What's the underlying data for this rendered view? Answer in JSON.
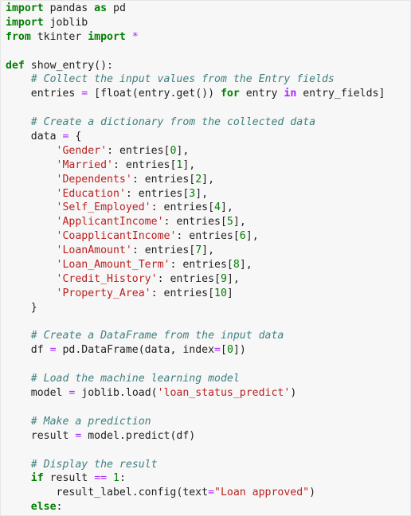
{
  "code_lines": [
    [
      {
        "t": "import",
        "c": "kw"
      },
      {
        "t": " pandas ",
        "c": "pl"
      },
      {
        "t": "as",
        "c": "kw"
      },
      {
        "t": " pd",
        "c": "pl"
      }
    ],
    [
      {
        "t": "import",
        "c": "kw"
      },
      {
        "t": " joblib",
        "c": "pl"
      }
    ],
    [
      {
        "t": "from",
        "c": "kw"
      },
      {
        "t": " tkinter ",
        "c": "pl"
      },
      {
        "t": "import",
        "c": "kw"
      },
      {
        "t": " ",
        "c": "pl"
      },
      {
        "t": "*",
        "c": "op"
      }
    ],
    [],
    [
      {
        "t": "def",
        "c": "kw"
      },
      {
        "t": " show_entry():",
        "c": "pl"
      }
    ],
    [
      {
        "t": "    ",
        "c": "pl"
      },
      {
        "t": "# Collect the input values from the Entry fields",
        "c": "com"
      }
    ],
    [
      {
        "t": "    entries ",
        "c": "pl"
      },
      {
        "t": "=",
        "c": "op"
      },
      {
        "t": " [float(entry.get()) ",
        "c": "pl"
      },
      {
        "t": "for",
        "c": "kw"
      },
      {
        "t": " entry ",
        "c": "pl"
      },
      {
        "t": "in",
        "c": "kw2"
      },
      {
        "t": " entry_fields]",
        "c": "pl"
      }
    ],
    [],
    [
      {
        "t": "    ",
        "c": "pl"
      },
      {
        "t": "# Create a dictionary from the collected data",
        "c": "com"
      }
    ],
    [
      {
        "t": "    data ",
        "c": "pl"
      },
      {
        "t": "=",
        "c": "op"
      },
      {
        "t": " {",
        "c": "pl"
      }
    ],
    [
      {
        "t": "        ",
        "c": "pl"
      },
      {
        "t": "'Gender'",
        "c": "str"
      },
      {
        "t": ": entries[",
        "c": "pl"
      },
      {
        "t": "0",
        "c": "num"
      },
      {
        "t": "],",
        "c": "pl"
      }
    ],
    [
      {
        "t": "        ",
        "c": "pl"
      },
      {
        "t": "'Married'",
        "c": "str"
      },
      {
        "t": ": entries[",
        "c": "pl"
      },
      {
        "t": "1",
        "c": "num"
      },
      {
        "t": "],",
        "c": "pl"
      }
    ],
    [
      {
        "t": "        ",
        "c": "pl"
      },
      {
        "t": "'Dependents'",
        "c": "str"
      },
      {
        "t": ": entries[",
        "c": "pl"
      },
      {
        "t": "2",
        "c": "num"
      },
      {
        "t": "],",
        "c": "pl"
      }
    ],
    [
      {
        "t": "        ",
        "c": "pl"
      },
      {
        "t": "'Education'",
        "c": "str"
      },
      {
        "t": ": entries[",
        "c": "pl"
      },
      {
        "t": "3",
        "c": "num"
      },
      {
        "t": "],",
        "c": "pl"
      }
    ],
    [
      {
        "t": "        ",
        "c": "pl"
      },
      {
        "t": "'Self_Employed'",
        "c": "str"
      },
      {
        "t": ": entries[",
        "c": "pl"
      },
      {
        "t": "4",
        "c": "num"
      },
      {
        "t": "],",
        "c": "pl"
      }
    ],
    [
      {
        "t": "        ",
        "c": "pl"
      },
      {
        "t": "'ApplicantIncome'",
        "c": "str"
      },
      {
        "t": ": entries[",
        "c": "pl"
      },
      {
        "t": "5",
        "c": "num"
      },
      {
        "t": "],",
        "c": "pl"
      }
    ],
    [
      {
        "t": "        ",
        "c": "pl"
      },
      {
        "t": "'CoapplicantIncome'",
        "c": "str"
      },
      {
        "t": ": entries[",
        "c": "pl"
      },
      {
        "t": "6",
        "c": "num"
      },
      {
        "t": "],",
        "c": "pl"
      }
    ],
    [
      {
        "t": "        ",
        "c": "pl"
      },
      {
        "t": "'LoanAmount'",
        "c": "str"
      },
      {
        "t": ": entries[",
        "c": "pl"
      },
      {
        "t": "7",
        "c": "num"
      },
      {
        "t": "],",
        "c": "pl"
      }
    ],
    [
      {
        "t": "        ",
        "c": "pl"
      },
      {
        "t": "'Loan_Amount_Term'",
        "c": "str"
      },
      {
        "t": ": entries[",
        "c": "pl"
      },
      {
        "t": "8",
        "c": "num"
      },
      {
        "t": "],",
        "c": "pl"
      }
    ],
    [
      {
        "t": "        ",
        "c": "pl"
      },
      {
        "t": "'Credit_History'",
        "c": "str"
      },
      {
        "t": ": entries[",
        "c": "pl"
      },
      {
        "t": "9",
        "c": "num"
      },
      {
        "t": "],",
        "c": "pl"
      }
    ],
    [
      {
        "t": "        ",
        "c": "pl"
      },
      {
        "t": "'Property_Area'",
        "c": "str"
      },
      {
        "t": ": entries[",
        "c": "pl"
      },
      {
        "t": "10",
        "c": "num"
      },
      {
        "t": "]",
        "c": "pl"
      }
    ],
    [
      {
        "t": "    }",
        "c": "pl"
      }
    ],
    [],
    [
      {
        "t": "    ",
        "c": "pl"
      },
      {
        "t": "# Create a DataFrame from the input data",
        "c": "com"
      }
    ],
    [
      {
        "t": "    df ",
        "c": "pl"
      },
      {
        "t": "=",
        "c": "op"
      },
      {
        "t": " pd.DataFrame(data, index",
        "c": "pl"
      },
      {
        "t": "=",
        "c": "op"
      },
      {
        "t": "[",
        "c": "pl"
      },
      {
        "t": "0",
        "c": "num"
      },
      {
        "t": "])",
        "c": "pl"
      }
    ],
    [],
    [
      {
        "t": "    ",
        "c": "pl"
      },
      {
        "t": "# Load the machine learning model",
        "c": "com"
      }
    ],
    [
      {
        "t": "    model ",
        "c": "pl"
      },
      {
        "t": "=",
        "c": "op"
      },
      {
        "t": " joblib.load(",
        "c": "pl"
      },
      {
        "t": "'loan_status_predict'",
        "c": "str"
      },
      {
        "t": ")",
        "c": "pl"
      }
    ],
    [],
    [
      {
        "t": "    ",
        "c": "pl"
      },
      {
        "t": "# Make a prediction",
        "c": "com"
      }
    ],
    [
      {
        "t": "    result ",
        "c": "pl"
      },
      {
        "t": "=",
        "c": "op"
      },
      {
        "t": " model.predict(df)",
        "c": "pl"
      }
    ],
    [],
    [
      {
        "t": "    ",
        "c": "pl"
      },
      {
        "t": "# Display the result",
        "c": "com"
      }
    ],
    [
      {
        "t": "    ",
        "c": "pl"
      },
      {
        "t": "if",
        "c": "kw"
      },
      {
        "t": " result ",
        "c": "pl"
      },
      {
        "t": "==",
        "c": "op"
      },
      {
        "t": " ",
        "c": "pl"
      },
      {
        "t": "1",
        "c": "num"
      },
      {
        "t": ":",
        "c": "pl"
      }
    ],
    [
      {
        "t": "        result_label.config(text",
        "c": "pl"
      },
      {
        "t": "=",
        "c": "op"
      },
      {
        "t": "\"Loan approved\"",
        "c": "str"
      },
      {
        "t": ")",
        "c": "pl"
      }
    ],
    [
      {
        "t": "    ",
        "c": "pl"
      },
      {
        "t": "else",
        "c": "kw"
      },
      {
        "t": ":",
        "c": "pl"
      }
    ]
  ]
}
